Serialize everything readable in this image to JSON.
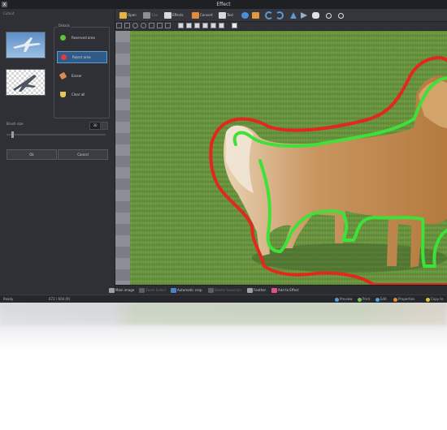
{
  "window": {
    "title": "Effect",
    "close_glyph": "x"
  },
  "left_panel": {
    "label": "Cutout",
    "details_label": "Details",
    "buttons": [
      {
        "label": "Reserved area",
        "color": "#5cc43c",
        "active": false
      },
      {
        "label": "Reject area",
        "color": "#e23b3b",
        "active": true
      },
      {
        "label": "Eraser",
        "color": "#d98b5a",
        "active": false
      },
      {
        "label": "Clear all",
        "color": "#e8c35a",
        "active": false
      }
    ],
    "brush_label": "Brush size",
    "brush_value": "30",
    "brush_level": 0.05,
    "ok_label": "Ok",
    "cancel_label": "Cancel"
  },
  "toolbar": {
    "items": [
      {
        "label": "Open",
        "icon": "folder-icon",
        "color": "#e3b53f",
        "enabled": true
      },
      {
        "label": "Size",
        "icon": "resize-icon",
        "color": "#8b8f96",
        "enabled": false
      },
      {
        "label": "Effects",
        "icon": "film-icon",
        "color": "#d6d9de",
        "enabled": true
      },
      {
        "label": "Convert",
        "icon": "convert-icon",
        "color": "#e08a3a",
        "enabled": true
      },
      {
        "label": "Text",
        "icon": "text-icon",
        "color": "#d6d9de",
        "enabled": true
      }
    ]
  },
  "bottom_bar": {
    "items": [
      {
        "label": "Main image",
        "icon": "image-icon",
        "color": "#9aa2ad",
        "enabled": true
      },
      {
        "label": "Zoom Select",
        "icon": "zoom-select-icon",
        "color": "#5a5d63",
        "enabled": false
      },
      {
        "label": "Automatic crop",
        "icon": "crop-icon",
        "color": "#4a84c4",
        "enabled": true
      },
      {
        "label": "Delete Selection",
        "icon": "delete-icon",
        "color": "#5a5d63",
        "enabled": false
      },
      {
        "label": "Feather",
        "icon": "feather-icon",
        "color": "#9aa2ad",
        "enabled": true
      },
      {
        "label": "Add to Effect",
        "icon": "heart-icon",
        "color": "#e0508c",
        "enabled": true
      }
    ]
  },
  "status_bar": {
    "left": "Ready",
    "center": "672 / 604 (R)",
    "right_items": [
      {
        "label": "Preview",
        "color": "#4aa3e0"
      },
      {
        "label": "Print",
        "color": "#6cc04a"
      },
      {
        "label": "Edit",
        "color": "#4aa3e0"
      },
      {
        "label": "Properties",
        "color": "#e08a3a"
      },
      {
        "label": "Copy to",
        "color": "#e0c03a"
      }
    ]
  },
  "colors": {
    "keep_outline": "#3fe03a",
    "reject_outline": "#e2281d",
    "accent": "#2f5b86"
  }
}
